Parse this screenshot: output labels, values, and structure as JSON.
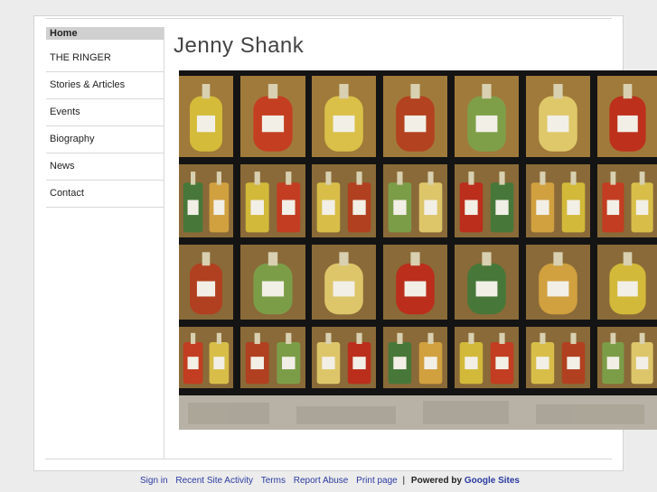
{
  "site": {
    "title": "Jenny Shank"
  },
  "nav": {
    "items": [
      {
        "label": "Home"
      },
      {
        "label": "THE RINGER"
      },
      {
        "label": "Stories & Articles"
      },
      {
        "label": "Events"
      },
      {
        "label": "Biography"
      },
      {
        "label": "News"
      },
      {
        "label": "Contact"
      }
    ]
  },
  "footer": {
    "sign_in": "Sign in",
    "recent_activity": "Recent Site Activity",
    "terms": "Terms",
    "report_abuse": "Report Abuse",
    "print_page": "Print page",
    "separator": "|",
    "powered_by": "Powered by",
    "google_sites": "Google Sites"
  },
  "colors": {
    "link": "#2a3aa0",
    "active_nav_bg": "#d0d0d0"
  }
}
